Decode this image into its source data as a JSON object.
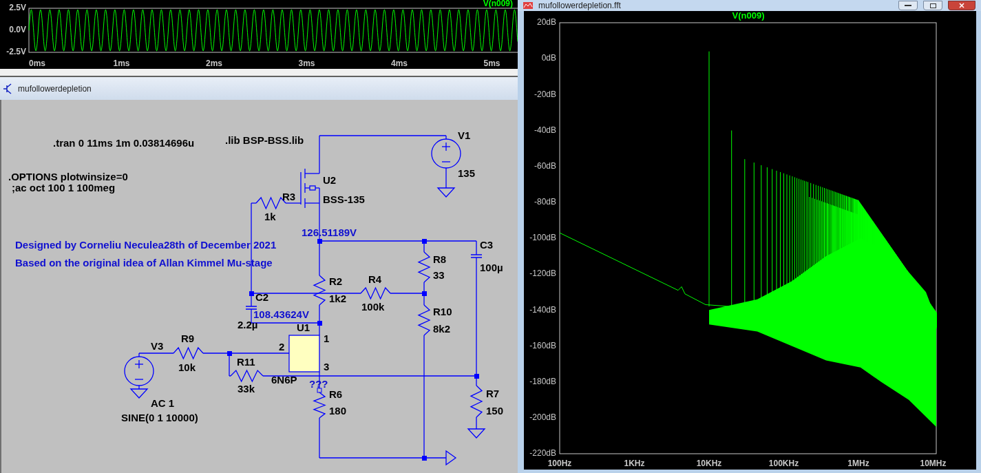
{
  "transient_plot": {
    "trace": "V(n009)",
    "y_ticks": [
      "2.5V",
      "0.0V",
      "-2.5V"
    ],
    "x_ticks": [
      "0ms",
      "1ms",
      "2ms",
      "3ms",
      "4ms",
      "5ms"
    ]
  },
  "schematic_window": {
    "title": "mufollowerdepletion"
  },
  "schematic": {
    "directives": [
      ".tran 0 11ms 1m 0.03814696u",
      ".lib BSP-BSS.lib",
      ".OPTIONS plotwinsize=0",
      ";ac oct 100 1 100meg"
    ],
    "comments": [
      "Designed by Corneliu Neculea28th of December 2021",
      "Based on the original idea of Allan Kimmel Mu-stage"
    ],
    "node_voltages": [
      "126.51189V",
      "108.43624V",
      "???"
    ],
    "pins": [
      "1",
      "2",
      "3"
    ],
    "components": [
      {
        "name": "V1",
        "values": [
          "135"
        ]
      },
      {
        "name": "U2",
        "values": [
          "BSS-135"
        ]
      },
      {
        "name": "R3",
        "values": [
          "1k"
        ]
      },
      {
        "name": "R8",
        "values": [
          "33"
        ]
      },
      {
        "name": "C3",
        "values": [
          "100µ"
        ]
      },
      {
        "name": "R2",
        "values": [
          "1k2"
        ]
      },
      {
        "name": "R4",
        "values": [
          "100k"
        ]
      },
      {
        "name": "C2",
        "values": [
          "2.2µ"
        ]
      },
      {
        "name": "U1",
        "values": [
          "6N6P"
        ]
      },
      {
        "name": "R10",
        "values": [
          "8k2"
        ]
      },
      {
        "name": "R9",
        "values": [
          "10k"
        ]
      },
      {
        "name": "V3",
        "values": [
          "AC 1",
          "SINE(0 1 10000)"
        ]
      },
      {
        "name": "R11",
        "values": [
          "33k"
        ]
      },
      {
        "name": "R6",
        "values": [
          "180"
        ]
      },
      {
        "name": "R7",
        "values": [
          "150"
        ]
      }
    ]
  },
  "fft_window": {
    "title": "mufollowerdepletion.fft",
    "trace": "V(n009)",
    "y_ticks": [
      "20dB",
      "0dB",
      "-20dB",
      "-40dB",
      "-60dB",
      "-80dB",
      "-100dB",
      "-120dB",
      "-140dB",
      "-160dB",
      "-180dB",
      "-200dB",
      "-220dB"
    ],
    "x_ticks": [
      "100Hz",
      "1KHz",
      "10KHz",
      "100KHz",
      "1MHz",
      "10MHz"
    ]
  }
}
